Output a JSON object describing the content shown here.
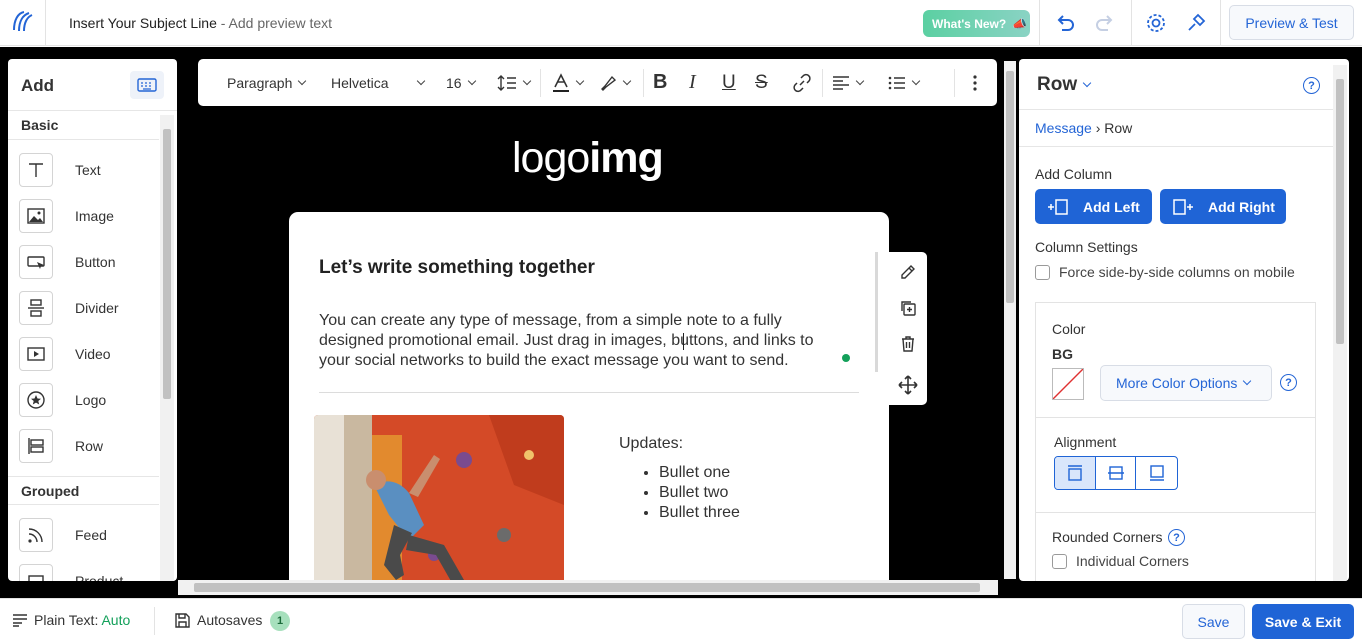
{
  "header": {
    "subject": "Insert Your Subject Line",
    "preview": " - Add preview text",
    "whats_new": "What's New?",
    "preview_test": "Preview & Test",
    "icons": [
      "app-logo-icon",
      "undo-icon",
      "redo-icon",
      "settings-gear-icon",
      "brush-icon"
    ]
  },
  "left_panel": {
    "title": "Add",
    "sections": {
      "basic": "Basic",
      "grouped": "Grouped"
    },
    "items": [
      {
        "label": "Text",
        "icon": "text-icon"
      },
      {
        "label": "Image",
        "icon": "image-icon"
      },
      {
        "label": "Button",
        "icon": "button-icon"
      },
      {
        "label": "Divider",
        "icon": "divider-icon"
      },
      {
        "label": "Video",
        "icon": "video-icon"
      },
      {
        "label": "Logo",
        "icon": "logo-icon"
      },
      {
        "label": "Row",
        "icon": "row-icon"
      }
    ],
    "grouped_items": [
      {
        "label": "Feed",
        "icon": "feed-icon"
      },
      {
        "label": "Product",
        "icon": "product-icon"
      }
    ]
  },
  "toolbar": {
    "paragraph": "Paragraph",
    "font": "Helvetica",
    "size": "16"
  },
  "canvas": {
    "logo_light": "logo",
    "logo_bold": "img",
    "heading": "Let’s write something together",
    "body": "You can create any type of message, from a simple note to a fully designed promotional email. Just drag in images, buttons, and links to your social networks to build the exact message you want to send.",
    "updates_label": "Updates:",
    "bullets": [
      "Bullet one",
      "Bullet two",
      "Bullet three"
    ]
  },
  "right_panel": {
    "title": "Row",
    "breadcrumb_parent": "Message",
    "breadcrumb_current": "Row",
    "add_column": "Add Column",
    "add_left": "Add Left",
    "add_right": "Add Right",
    "column_settings": "Column Settings",
    "force_mobile": "Force side-by-side columns on mobile",
    "color": "Color",
    "bg": "BG",
    "more_colors": "More Color Options",
    "alignment": "Alignment",
    "rounded_corners": "Rounded Corners",
    "individual_corners": "Individual Corners",
    "help_glyph": "?"
  },
  "footer": {
    "plain_text_label": "Plain Text:",
    "plain_text_value": "Auto",
    "autosaves": "Autosaves",
    "autosaves_count": "1",
    "save": "Save",
    "save_exit": "Save & Exit"
  },
  "colors": {
    "accent": "#1f64d6",
    "whats_new": "#5bd0a2",
    "success": "#13a05a"
  }
}
